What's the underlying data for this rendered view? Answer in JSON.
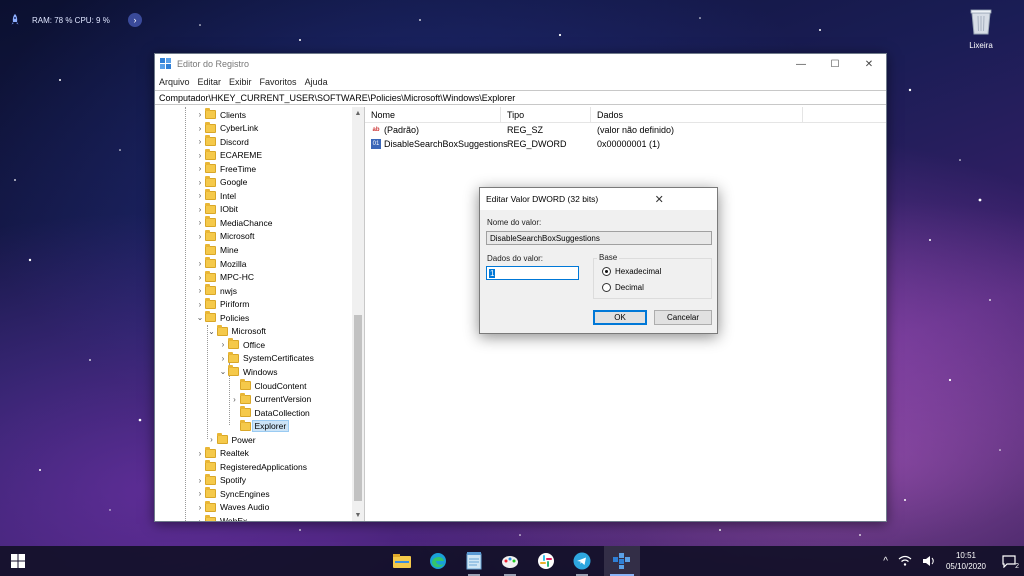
{
  "desktop": {
    "sysmon": {
      "text": "RAM: 78 %  CPU: 9 %",
      "arrow": "›"
    },
    "recycle_bin": {
      "label": "Lixeira"
    }
  },
  "window": {
    "title": "Editor do Registro",
    "controls": {
      "minimize": "—",
      "maximize": "☐",
      "close": "✕"
    },
    "menu": [
      "Arquivo",
      "Editar",
      "Exibir",
      "Favoritos",
      "Ajuda"
    ],
    "address": "Computador\\HKEY_CURRENT_USER\\SOFTWARE\\Policies\\Microsoft\\Windows\\Explorer",
    "tree": [
      {
        "label": "Clients",
        "depth": 0,
        "chev": ">"
      },
      {
        "label": "CyberLink",
        "depth": 0,
        "chev": ">"
      },
      {
        "label": "Discord",
        "depth": 0,
        "chev": ">"
      },
      {
        "label": "ECAREME",
        "depth": 0,
        "chev": ">"
      },
      {
        "label": "FreeTime",
        "depth": 0,
        "chev": ">"
      },
      {
        "label": "Google",
        "depth": 0,
        "chev": ">"
      },
      {
        "label": "Intel",
        "depth": 0,
        "chev": ">"
      },
      {
        "label": "IObit",
        "depth": 0,
        "chev": ">"
      },
      {
        "label": "MediaChance",
        "depth": 0,
        "chev": ">"
      },
      {
        "label": "Microsoft",
        "depth": 0,
        "chev": ">"
      },
      {
        "label": "Mine",
        "depth": 0,
        "chev": ""
      },
      {
        "label": "Mozilla",
        "depth": 0,
        "chev": ">"
      },
      {
        "label": "MPC-HC",
        "depth": 0,
        "chev": ">"
      },
      {
        "label": "nwjs",
        "depth": 0,
        "chev": ">"
      },
      {
        "label": "Piriform",
        "depth": 0,
        "chev": ">"
      },
      {
        "label": "Policies",
        "depth": 0,
        "chev": "v"
      },
      {
        "label": "Microsoft",
        "depth": 1,
        "chev": "v"
      },
      {
        "label": "Office",
        "depth": 2,
        "chev": ">"
      },
      {
        "label": "SystemCertificates",
        "depth": 2,
        "chev": ">"
      },
      {
        "label": "Windows",
        "depth": 2,
        "chev": "v"
      },
      {
        "label": "CloudContent",
        "depth": 3,
        "chev": ""
      },
      {
        "label": "CurrentVersion",
        "depth": 3,
        "chev": ">"
      },
      {
        "label": "DataCollection",
        "depth": 3,
        "chev": ""
      },
      {
        "label": "Explorer",
        "depth": 3,
        "chev": "",
        "selected": true
      },
      {
        "label": "Power",
        "depth": 1,
        "chev": ">"
      },
      {
        "label": "Realtek",
        "depth": 0,
        "chev": ">"
      },
      {
        "label": "RegisteredApplications",
        "depth": 0,
        "chev": ""
      },
      {
        "label": "Spotify",
        "depth": 0,
        "chev": ">"
      },
      {
        "label": "SyncEngines",
        "depth": 0,
        "chev": ">"
      },
      {
        "label": "Waves Audio",
        "depth": 0,
        "chev": ">"
      },
      {
        "label": "WebEx",
        "depth": 0,
        "chev": ">"
      }
    ],
    "list": {
      "headers": [
        "Nome",
        "Tipo",
        "Dados"
      ],
      "rows": [
        {
          "icon": "string-value-icon",
          "name": "(Padrão)",
          "type": "REG_SZ",
          "data": "(valor não definido)"
        },
        {
          "icon": "dword-value-icon",
          "name": "DisableSearchBoxSuggestions",
          "type": "REG_DWORD",
          "data": "0x00000001 (1)"
        }
      ]
    }
  },
  "dialog": {
    "title": "Editar Valor DWORD (32 bits)",
    "close": "✕",
    "name_label": "Nome do valor:",
    "name_value": "DisableSearchBoxSuggestions",
    "data_label": "Dados do valor:",
    "data_value": "1",
    "base_label": "Base",
    "base_options": [
      {
        "label": "Hexadecimal",
        "selected": true
      },
      {
        "label": "Decimal",
        "selected": false
      }
    ],
    "ok": "OK",
    "cancel": "Cancelar"
  },
  "taskbar": {
    "apps": [
      "file-explorer-icon",
      "edge-icon",
      "notepad-icon",
      "paint-icon",
      "slack-icon",
      "telegram-icon",
      "regedit-icon"
    ],
    "clock_time": "10:51",
    "clock_date": "05/10/2020",
    "notification_count": "2",
    "tray_chevron": "^"
  },
  "colors": {
    "accent": "#0078d7",
    "folder": "#f5c94a",
    "selection": "#cce4f7"
  }
}
